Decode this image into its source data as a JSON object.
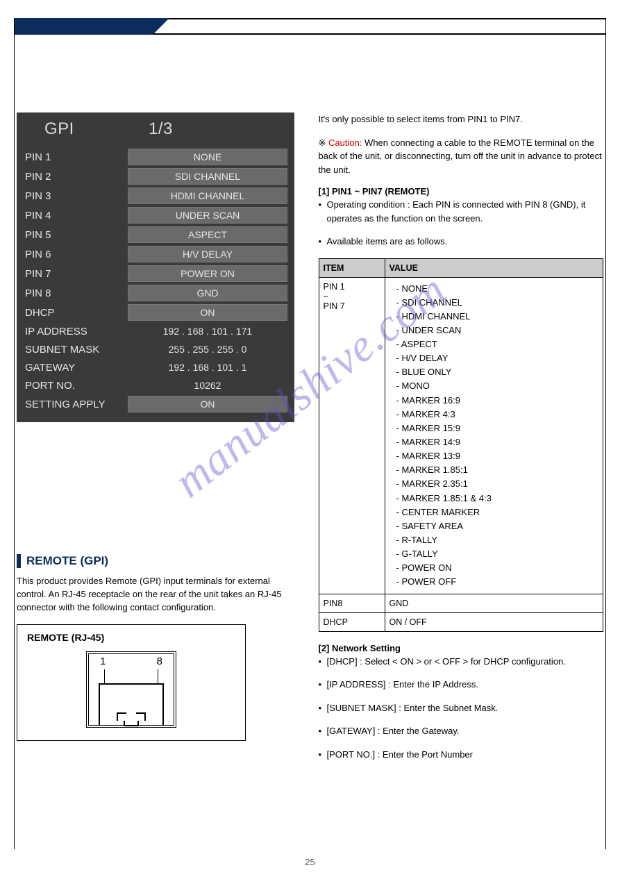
{
  "gpi": {
    "title": "GPI",
    "pager": "1/3",
    "rows": [
      {
        "label": "PIN 1",
        "btn": "NONE"
      },
      {
        "label": "PIN 2",
        "btn": "SDI CHANNEL"
      },
      {
        "label": "PIN 3",
        "btn": "HDMI CHANNEL"
      },
      {
        "label": "PIN 4",
        "btn": "UNDER SCAN"
      },
      {
        "label": "PIN 5",
        "btn": "ASPECT"
      },
      {
        "label": "PIN 6",
        "btn": "H/V DELAY"
      },
      {
        "label": "PIN 7",
        "btn": "POWER ON"
      },
      {
        "label": "PIN 8",
        "btn": "GND"
      },
      {
        "label": "DHCP",
        "btn": "ON"
      }
    ],
    "textrows": [
      {
        "label": "IP ADDRESS",
        "value": "192 . 168 . 101 . 171"
      },
      {
        "label": "SUBNET MASK",
        "value": "255 . 255 . 255 .  0"
      },
      {
        "label": "GATEWAY",
        "value": "192 . 168 . 101 .  1"
      },
      {
        "label": "PORT NO.",
        "value": "10262"
      }
    ],
    "lastrow": {
      "label": "SETTING APPLY",
      "btn": "ON"
    }
  },
  "remote": {
    "heading": "REMOTE (GPI)",
    "desc": "This product provides Remote (GPI) input terminals for external control. An RJ-45 receptacle on the rear of the unit takes an RJ-45 connector with the following contact configuration.",
    "box_title": "REMOTE (RJ-45)",
    "n1": "1",
    "n8": "8"
  },
  "right": {
    "hint": "It's only possible to select items from PIN1 to PIN7.",
    "caution_label": "Caution:",
    "caution": " When connecting a cable to the REMOTE terminal on the back of the unit, or disconnecting, turn off the unit in advance to protect the unit.",
    "sub1": "[1] PIN1 ~ PIN7 (REMOTE)",
    "sub1_b1": "Operating condition : Each PIN is connected with PIN 8 (GND), it operates as the function on the screen.",
    "sub1_b2": "Available items are as follows.",
    "table": {
      "headers": [
        "ITEM",
        "VALUE"
      ],
      "row1": {
        "item": "PIN 1\n~\nPIN 7",
        "values": [
          "NONE",
          "SDI CHANNEL",
          "HDMI CHANNEL",
          "UNDER SCAN",
          "ASPECT",
          "H/V DELAY",
          "BLUE ONLY",
          "MONO",
          "MARKER 16:9",
          "MARKER 4:3",
          "MARKER 15:9",
          "MARKER 14:9",
          "MARKER 13:9",
          "MARKER 1.85:1",
          "MARKER 2.35:1",
          "MARKER 1.85:1 & 4:3",
          "CENTER MARKER",
          "SAFETY AREA",
          "R-TALLY",
          "G-TALLY",
          "POWER ON",
          "POWER OFF"
        ]
      },
      "row2": {
        "item": "PIN8",
        "value": "GND"
      },
      "row3": {
        "item": "DHCP",
        "value": "ON / OFF"
      }
    },
    "net_heading": "[2] Network Setting",
    "net_items": [
      "[DHCP] : Select < ON > or < OFF > for DHCP configuration.",
      "[IP ADDRESS] : Enter the IP Address.",
      "[SUBNET MASK] : Enter the Subnet Mask.",
      "[GATEWAY] : Enter the Gateway.",
      "[PORT NO.] : Enter the Port Number"
    ]
  },
  "watermark": "manualshive.com",
  "page_num": "25"
}
